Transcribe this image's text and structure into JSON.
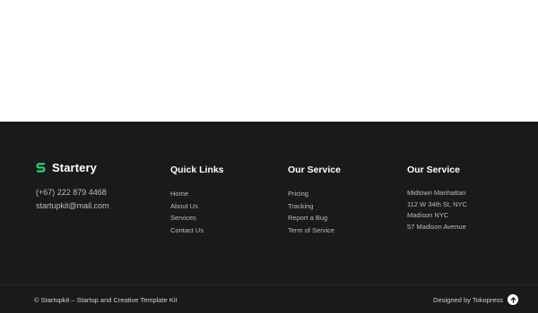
{
  "brand": {
    "name": "Startery",
    "logo_icon": "s-logo-icon",
    "accent_color": "#2ecc71"
  },
  "contact": {
    "phone": "(+67) 222 879 4468",
    "email": "startupkit@mail.com"
  },
  "quick_links": {
    "title": "Quick Links",
    "items": [
      "Home",
      "About Us",
      "Services",
      "Contact Us"
    ]
  },
  "services": {
    "title": "Our Service",
    "items": [
      "Pricing",
      "Tracking",
      "Report a Bug",
      "Term of Service"
    ]
  },
  "address": {
    "title": "Our Service",
    "lines": [
      "Midtown Manhattan",
      "112 W 34th St, NYC",
      "Madison NYC",
      "57 Madison Avenue"
    ]
  },
  "bottom_bar": {
    "copyright": "© Startupkit – Startup and Creative Template Kit",
    "designed_by": "Designed by Tokopress",
    "back_to_top_icon": "arrow-up-icon"
  }
}
